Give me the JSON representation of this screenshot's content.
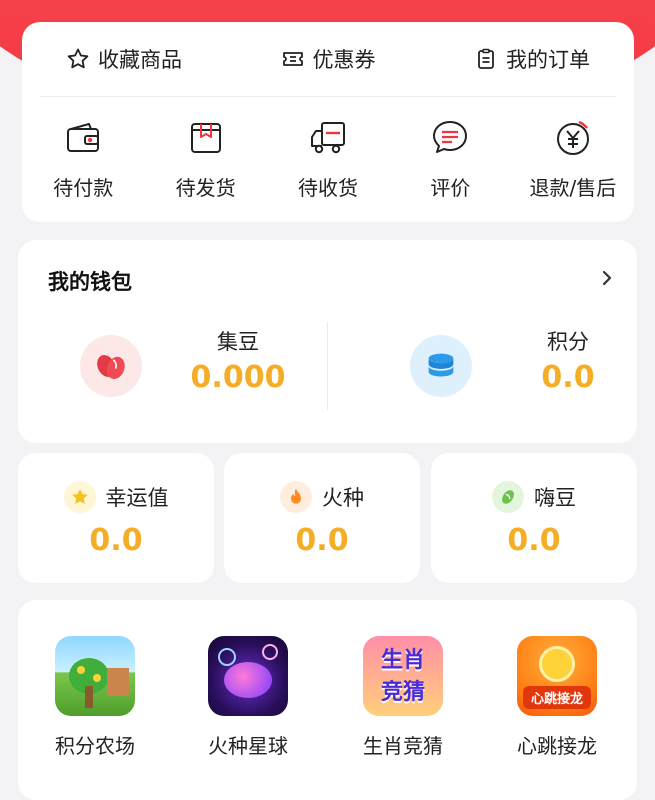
{
  "quick_links": [
    {
      "label": "收藏商品",
      "icon": "star-icon"
    },
    {
      "label": "优惠券",
      "icon": "coupon-icon"
    },
    {
      "label": "我的订单",
      "icon": "order-list-icon"
    }
  ],
  "orders": [
    {
      "label": "待付款",
      "icon": "wallet-icon"
    },
    {
      "label": "待发货",
      "icon": "package-icon"
    },
    {
      "label": "待收货",
      "icon": "truck-icon"
    },
    {
      "label": "评价",
      "icon": "comment-icon"
    },
    {
      "label": "退款/售后",
      "icon": "refund-icon"
    }
  ],
  "wallet": {
    "title": "我的钱包",
    "items": [
      {
        "label": "集豆",
        "value": "0.000",
        "icon": "bean-icon"
      },
      {
        "label": "积分",
        "value": "0.0",
        "icon": "coins-stack-icon"
      }
    ]
  },
  "stats": [
    {
      "label": "幸运值",
      "value": "0.0",
      "icon": "star-icon"
    },
    {
      "label": "火种",
      "value": "0.0",
      "icon": "flame-icon"
    },
    {
      "label": "嗨豆",
      "value": "0.0",
      "icon": "green-bean-icon"
    }
  ],
  "games": [
    {
      "label": "积分农场",
      "icon": "farm-game-icon"
    },
    {
      "label": "火种星球",
      "icon": "planet-game-icon"
    },
    {
      "label": "生肖竞猜",
      "icon": "zodiac-game-icon",
      "tile_text": [
        "生肖",
        "竞猜"
      ]
    },
    {
      "label": "心跳接龙",
      "icon": "heartbeat-game-icon",
      "tile_text": [
        "心跳接龙"
      ]
    }
  ],
  "colors": {
    "accent_red": "#f2343f",
    "value_yellow": "#f4ad25"
  }
}
